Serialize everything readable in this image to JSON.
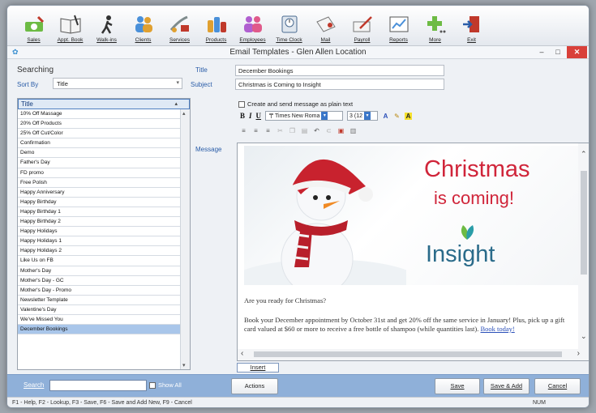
{
  "toolbar": {
    "items": [
      {
        "label": "Sales",
        "icon": "sales-icon"
      },
      {
        "label": "Appt. Book",
        "icon": "appointment-book-icon"
      },
      {
        "label": "Walk-ins",
        "icon": "walk-ins-icon"
      },
      {
        "label": "Clients",
        "icon": "clients-icon"
      },
      {
        "label": "Services",
        "icon": "services-icon"
      },
      {
        "label": "Products",
        "icon": "products-icon"
      },
      {
        "label": "Employees",
        "icon": "employees-icon"
      },
      {
        "label": "Time Clock",
        "icon": "time-clock-icon"
      },
      {
        "label": "Mail",
        "icon": "mail-icon"
      },
      {
        "label": "Payroll",
        "icon": "payroll-icon"
      },
      {
        "label": "Reports",
        "icon": "reports-icon"
      },
      {
        "label": "More",
        "icon": "more-icon"
      },
      {
        "label": "Exit",
        "icon": "exit-icon"
      }
    ]
  },
  "window": {
    "title": "Email Templates - Glen Allen Location",
    "minimize": "–",
    "maximize": "□",
    "close": "✕"
  },
  "left": {
    "heading": "Searching",
    "sort_by_label": "Sort By",
    "sort_by_value": "Title",
    "list_header": "Title",
    "items": [
      "10% Off Massage",
      "20% Off Products",
      "25% Off Cut/Color",
      "Confirmation",
      "Demo",
      "Father's Day",
      "FD promo",
      "Free Polish",
      "Happy Anniversary",
      "Happy Birthday",
      "Happy Birthday 1",
      "Happy Birthday 2",
      "Happy Holidays",
      "Happy Holidays 1",
      "Happy Holidays 2",
      "Like Us on FB",
      "Mother's Day",
      "Mother's Day - GC",
      "Mother's Day - Promo",
      "Newsletter Template",
      "Valentine's Day",
      "We've Missed You",
      "December Bookings"
    ],
    "selected_item": "December Bookings"
  },
  "form": {
    "title_label": "Title",
    "title_value": "December Bookings",
    "subject_label": "Subject",
    "subject_value": "Christmas is Coming to Insight",
    "plain_text_label": "Create and send message as plain text",
    "message_label": "Message",
    "font_name": "Times New Roma",
    "font_size": "3 (12"
  },
  "message": {
    "banner_line1": "Christmas",
    "banner_line2": "is coming!",
    "banner_logo": "Insight",
    "para1": "Are you ready for Christmas?",
    "para2": "Book your December appointment by October 31st and get 20% off the same service in January! Plus, pick up a gift card valued at $60 or more to receive a free bottle of shampoo (while quantities last).",
    "link": "Book today!"
  },
  "insert_label": "Insert",
  "bottom": {
    "search_label": "Search",
    "search_value": "",
    "show_all_label": "Show All",
    "actions_label": "Actions",
    "save_label": "Save",
    "save_add_label": "Save & Add",
    "cancel_label": "Cancel"
  },
  "status": {
    "help_text": "F1 - Help, F2 - Lookup, F3 - Save, F6 - Save and Add New, F9 - Cancel",
    "num": "NUM"
  },
  "colors": {
    "accent": "#2a5da8",
    "bottom_bar": "#8fb0d9",
    "selected_row": "#a9c6ea",
    "banner_red": "#d0253a",
    "logo_teal": "#2a6b8a"
  }
}
